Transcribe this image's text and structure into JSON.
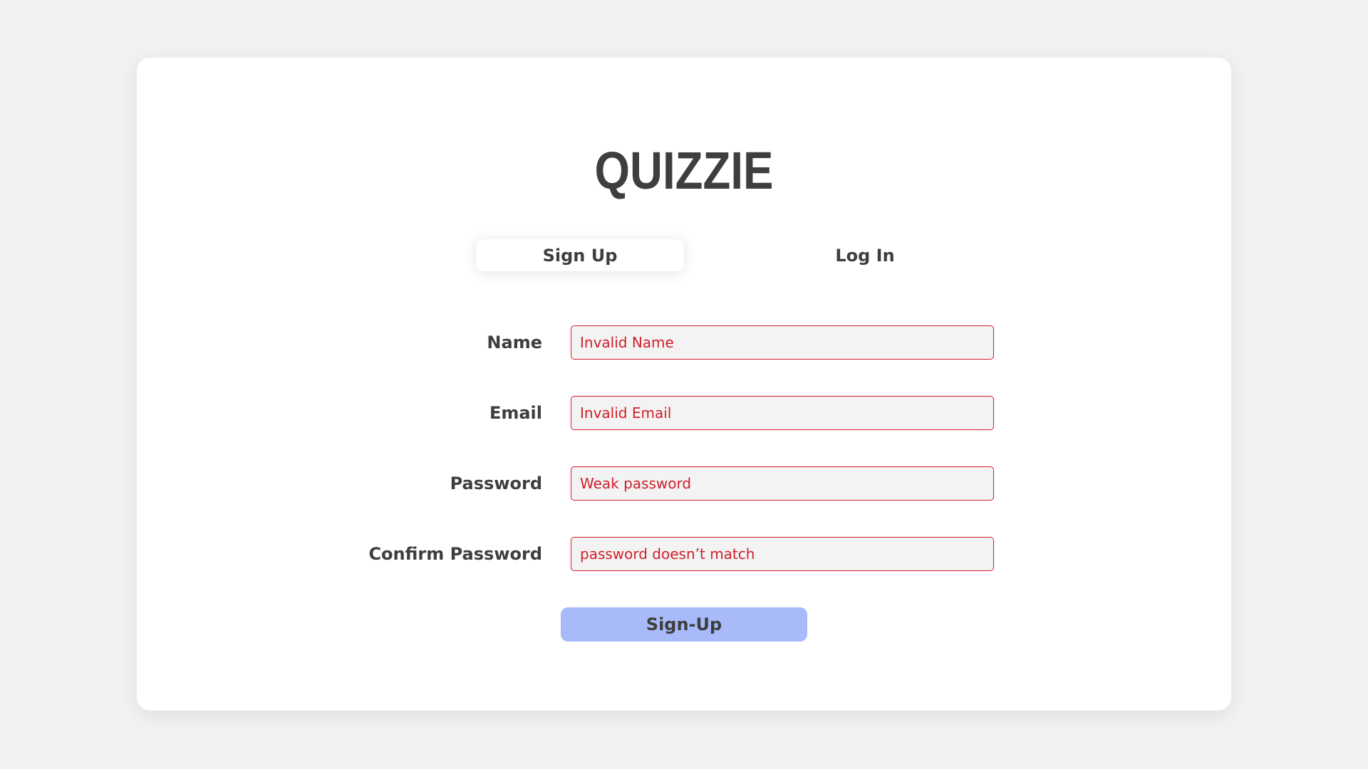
{
  "app": {
    "logo": "QUIZZIE"
  },
  "tabs": {
    "signup": "Sign Up",
    "login": "Log In",
    "active": "signup"
  },
  "form": {
    "fields": [
      {
        "label": "Name",
        "placeholder": "Invalid Name"
      },
      {
        "label": "Email",
        "placeholder": "Invalid Email"
      },
      {
        "label": "Password",
        "placeholder": "Weak password"
      },
      {
        "label": "Confirm Password",
        "placeholder": "password doesn’t match"
      }
    ],
    "submit_label": "Sign-Up"
  },
  "colors": {
    "background": "#f2f2f2",
    "card": "#ffffff",
    "text": "#3e3e3e",
    "error": "#cf1f2a",
    "input_bg": "#f3f3f3",
    "button": "#a8baf9"
  }
}
